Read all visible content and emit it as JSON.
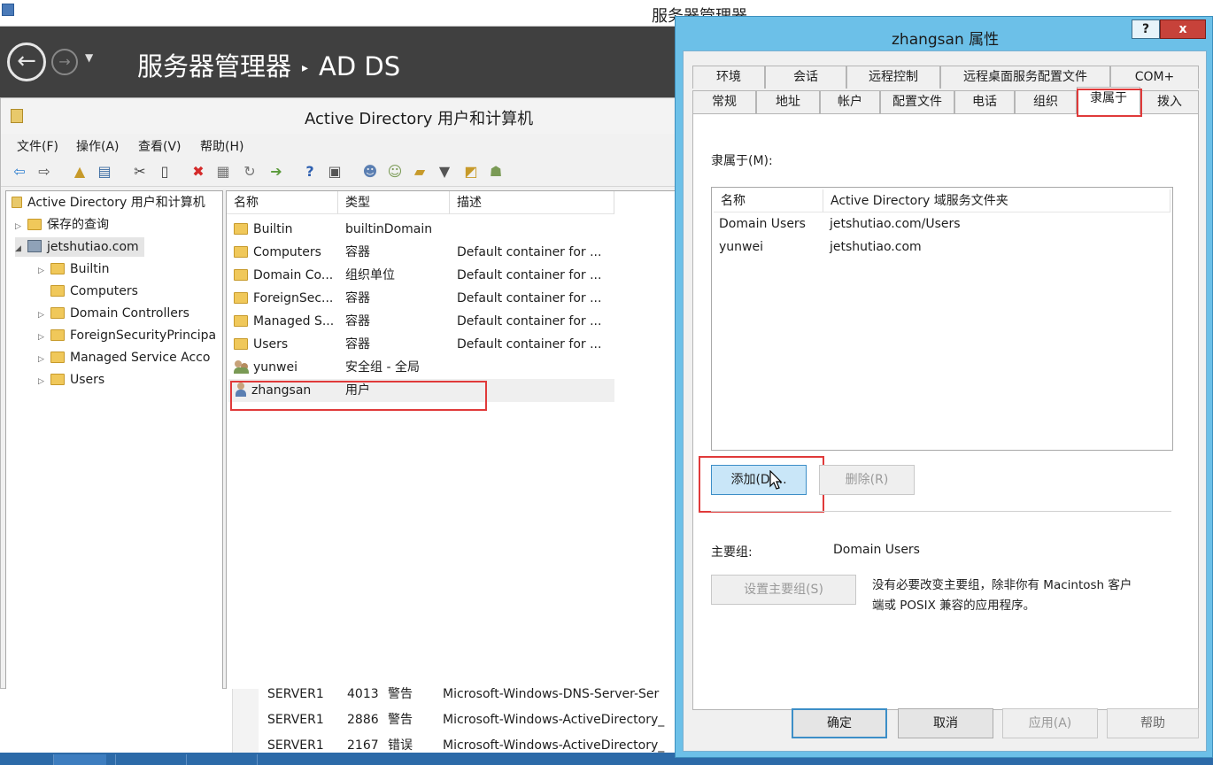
{
  "server_manager": {
    "title": "服务器管理器",
    "breadcrumb_root": "服务器管理器",
    "breadcrumb_sep": "▸",
    "breadcrumb_current": "AD DS"
  },
  "ad_window": {
    "title": "Active Directory 用户和计算机",
    "menu": [
      "文件(F)",
      "操作(A)",
      "查看(V)",
      "帮助(H)"
    ],
    "tree": {
      "root": "Active Directory 用户和计算机",
      "saved_queries": "保存的查询",
      "domain": "jetshutiao.com",
      "children": [
        "Builtin",
        "Computers",
        "Domain Controllers",
        "ForeignSecurityPrincipa",
        "Managed Service Acco",
        "Users"
      ]
    },
    "list": {
      "headers": [
        "名称",
        "类型",
        "描述"
      ],
      "rows": [
        {
          "name": "Builtin",
          "type": "builtinDomain",
          "desc": ""
        },
        {
          "name": "Computers",
          "type": "容器",
          "desc": "Default container for ..."
        },
        {
          "name": "Domain Co...",
          "type": "组织单位",
          "desc": "Default container for ..."
        },
        {
          "name": "ForeignSec...",
          "type": "容器",
          "desc": "Default container for ..."
        },
        {
          "name": "Managed S...",
          "type": "容器",
          "desc": "Default container for ..."
        },
        {
          "name": "Users",
          "type": "容器",
          "desc": "Default container for ..."
        },
        {
          "name": "yunwei",
          "type": "安全组 - 全局",
          "desc": ""
        },
        {
          "name": "zhangsan",
          "type": "用户",
          "desc": ""
        }
      ]
    }
  },
  "events": [
    {
      "server": "SERVER1",
      "id": "4013",
      "level": "警告",
      "source": "Microsoft-Windows-DNS-Server-Ser"
    },
    {
      "server": "SERVER1",
      "id": "2886",
      "level": "警告",
      "source": "Microsoft-Windows-ActiveDirectory_"
    },
    {
      "server": "SERVER1",
      "id": "2167",
      "level": "错误",
      "source": "Microsoft-Windows-ActiveDirectory_"
    }
  ],
  "dialog": {
    "title": "zhangsan 属性",
    "help": "?",
    "close": "x",
    "tabs_row1": [
      "环境",
      "会话",
      "远程控制",
      "远程桌面服务配置文件",
      "COM+"
    ],
    "tabs_row2": [
      "常规",
      "地址",
      "帐户",
      "配置文件",
      "电话",
      "组织",
      "隶属于",
      "拨入"
    ],
    "member_of_label": "隶属于(M):",
    "member_headers": [
      "名称",
      "Active Directory 域服务文件夹"
    ],
    "members": [
      {
        "name": "Domain Users",
        "folder": "jetshutiao.com/Users"
      },
      {
        "name": "yunwei",
        "folder": "jetshutiao.com"
      }
    ],
    "add_button": "添加(D)...",
    "remove_button": "删除(R)",
    "primary_group_label": "主要组:",
    "primary_group_value": "Domain Users",
    "set_primary_button": "设置主要组(S)",
    "primary_note_line1": "没有必要改变主要组，除非你有 Macintosh 客户",
    "primary_note_line2": "端或 POSIX 兼容的应用程序。",
    "ok": "确定",
    "cancel": "取消",
    "apply": "应用(A)",
    "help_button": "帮助"
  }
}
